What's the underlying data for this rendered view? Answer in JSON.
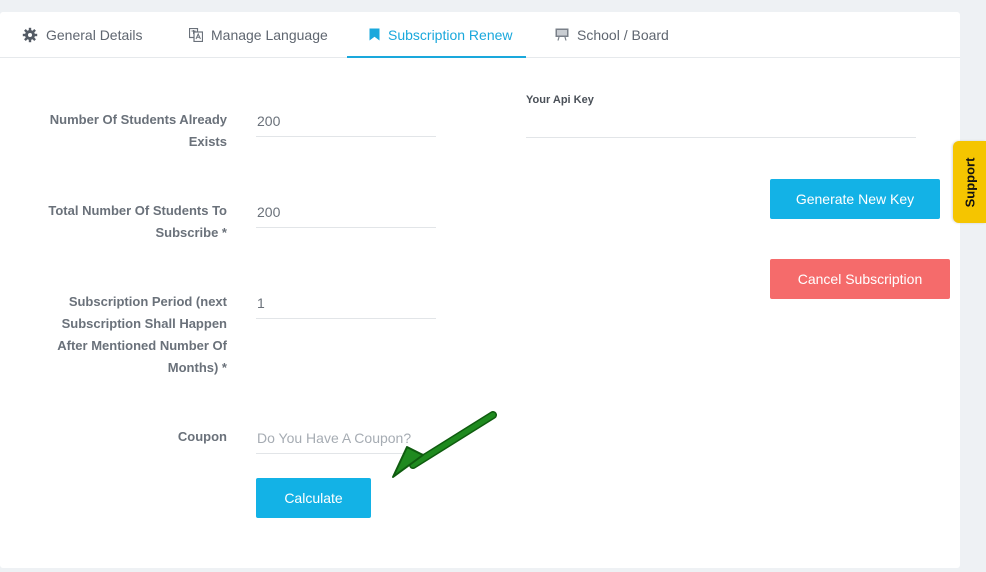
{
  "tabs": [
    {
      "label": "General Details",
      "icon": "gear-icon"
    },
    {
      "label": "Manage Language",
      "icon": "translate-icon"
    },
    {
      "label": "Subscription Renew",
      "icon": "bookmark-icon",
      "active": true
    },
    {
      "label": "School / Board",
      "icon": "presentation-board-icon"
    }
  ],
  "form": {
    "students_existing_label": "Number Of Students Already Exists",
    "students_existing_value": "200",
    "students_total_label": "Total Number Of Students To Subscribe *",
    "students_total_value": "200",
    "period_label": "Subscription Period (next Subscription Shall Happen After Mentioned Number Of Months) *",
    "period_value": "1",
    "coupon_label": "Coupon",
    "coupon_placeholder": "Do You Have A Coupon?",
    "calculate_label": "Calculate"
  },
  "api": {
    "label": "Your Api Key",
    "value": "",
    "generate_label": "Generate New Key",
    "cancel_label": "Cancel Subscription"
  },
  "support": {
    "label": "Support"
  },
  "colors": {
    "accent": "#1aa8dc",
    "button_blue": "#13b2e6",
    "button_red": "#f56b6b",
    "support_yellow": "#f5c500",
    "arrow_green": "#1f8a1f"
  }
}
